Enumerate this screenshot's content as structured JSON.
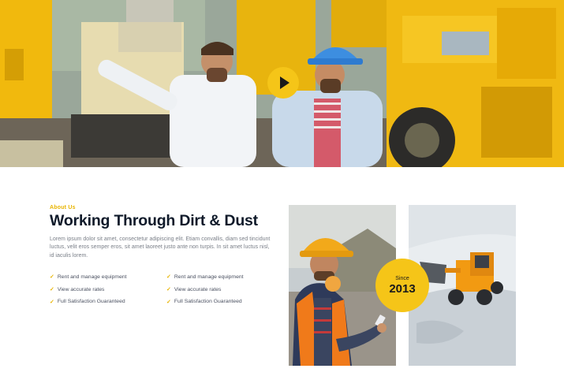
{
  "hero": {
    "image_name": "engineers-at-construction-site",
    "accent_color": "#f5c518"
  },
  "about": {
    "eyebrow": "About Us",
    "title": "Working Through Dirt & Dust",
    "description": "Lorem ipsum dolor sit amet, consectetur adipiscing elit. Etiam convallis, diam sed tincidunt luctus, velit eros semper eros, sit amet laoreet justo ante non turpis. In sit amet luctus nisl, id iaculis lorem.",
    "features": [
      "Rent and manage equipment",
      "Rent and manage equipment",
      "View accurate rates",
      "View accurate rates",
      "Full Satisfaction Guaranteed",
      "Full Satisfaction Guaranteed"
    ]
  },
  "badge": {
    "label": "Since",
    "year": "2013"
  }
}
